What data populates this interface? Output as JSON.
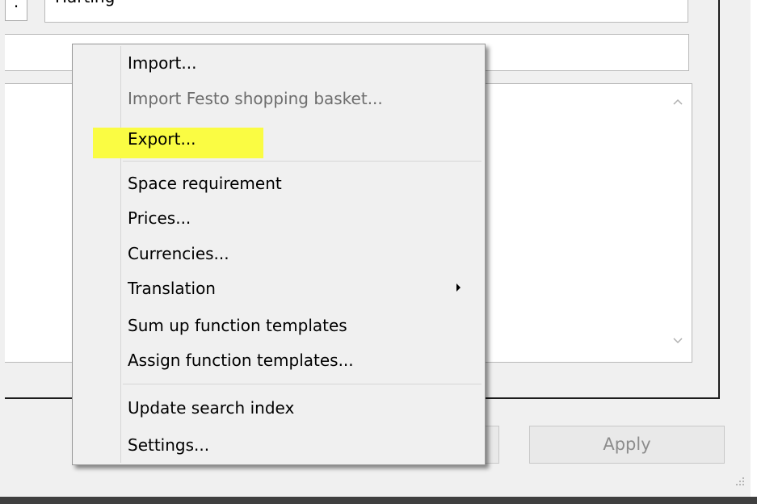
{
  "window": {
    "manufacturer_value": "Harting",
    "small_button_label": "·",
    "text_field_value": "",
    "apply_label": "Apply",
    "hidden_button_label": ""
  },
  "context_menu": {
    "items": [
      {
        "label": "Import...",
        "enabled": true
      },
      {
        "label": "Import Festo shopping basket...",
        "enabled": false
      },
      {
        "label": "Export...",
        "enabled": true,
        "highlighted": true
      },
      {
        "label": "Space requirement",
        "enabled": true
      },
      {
        "label": "Prices...",
        "enabled": true
      },
      {
        "label": "Currencies...",
        "enabled": true
      },
      {
        "label": "Translation",
        "enabled": true,
        "submenu": true
      },
      {
        "label": "Sum up function templates",
        "enabled": true
      },
      {
        "label": "Assign function templates...",
        "enabled": true
      },
      {
        "label": "Update search index",
        "enabled": true
      },
      {
        "label": "Settings...",
        "enabled": true
      }
    ],
    "highlight_color": "#fafc43"
  },
  "icons": {
    "scroll_up": "chevron-up-icon",
    "scroll_down": "chevron-down-icon",
    "submenu": "submenu-arrow-icon",
    "grip": "resize-grip-icon"
  }
}
